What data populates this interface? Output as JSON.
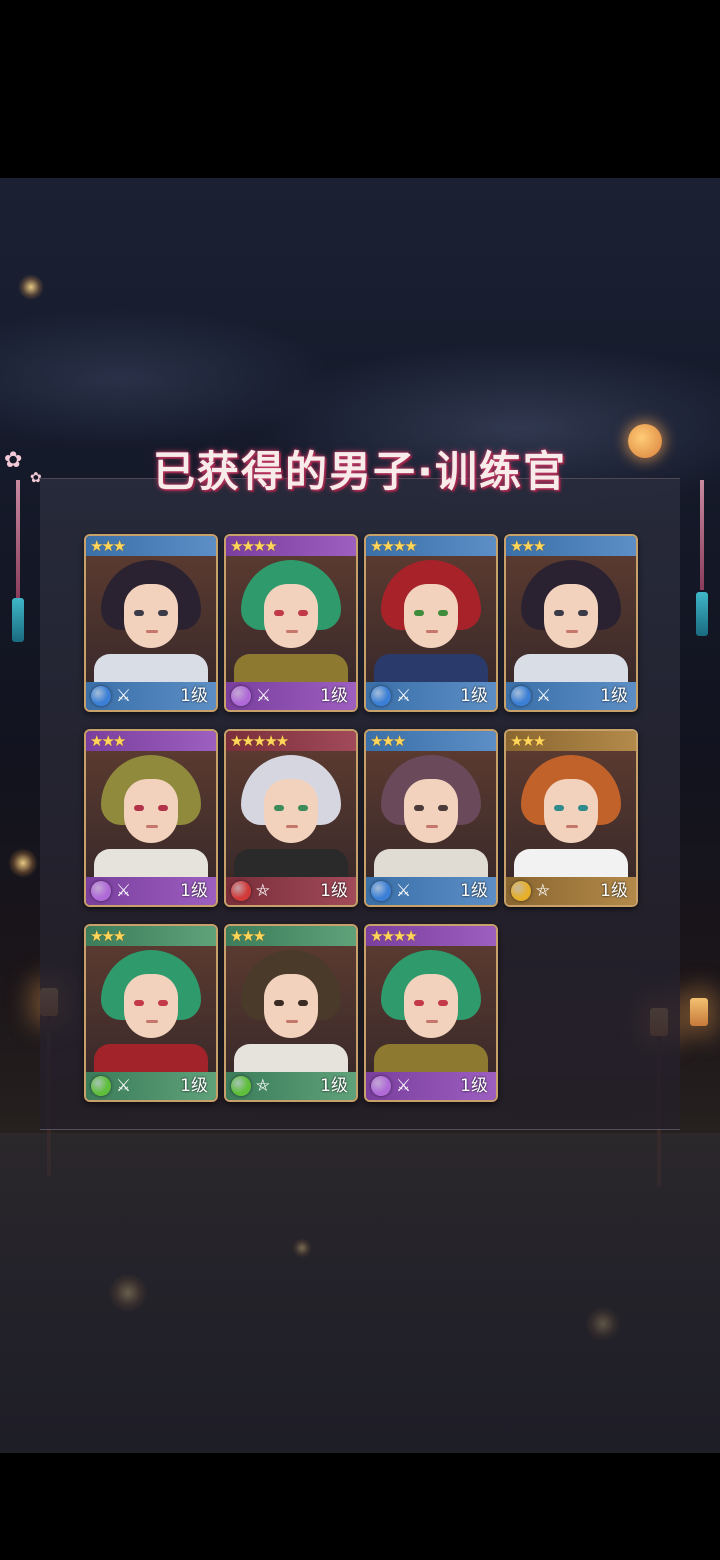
{
  "title": "已获得的男子·训练官",
  "cards": [
    {
      "stars": "★★★",
      "attr": "water",
      "weapon": "swords",
      "level": "1级",
      "frame": "blue",
      "hair": "#2a2230",
      "eye": "#3b3b48",
      "outfit": "#d9dde6"
    },
    {
      "stars": "★★★★",
      "attr": "wind",
      "weapon": "swords",
      "level": "1级",
      "frame": "purple",
      "hair": "#2f9a6c",
      "eye": "#c23a48",
      "outfit": "#8d7a30"
    },
    {
      "stars": "★★★★",
      "attr": "water",
      "weapon": "swords",
      "level": "1级",
      "frame": "blue",
      "hair": "#a8222a",
      "eye": "#3f8c3c",
      "outfit": "#2a3a6a"
    },
    {
      "stars": "★★★",
      "attr": "water",
      "weapon": "swords",
      "level": "1级",
      "frame": "blue",
      "hair": "#2a2230",
      "eye": "#3b3b48",
      "outfit": "#d9dde6"
    },
    {
      "stars": "★★★",
      "attr": "wind",
      "weapon": "swords",
      "level": "1级",
      "frame": "purple",
      "hair": "#8f8a3c",
      "eye": "#b2324a",
      "outfit": "#e6e2dc"
    },
    {
      "stars": "★★★★★",
      "attr": "fire",
      "weapon": "pentagram",
      "level": "1级",
      "frame": "red",
      "hair": "#d6d6e0",
      "eye": "#3c8c5a",
      "outfit": "#2a2a2a"
    },
    {
      "stars": "★★★",
      "attr": "water",
      "weapon": "swords",
      "level": "1级",
      "frame": "blue",
      "hair": "#6a4a5a",
      "eye": "#4a3a3a",
      "outfit": "#e0dcd4"
    },
    {
      "stars": "★★★",
      "attr": "earth",
      "weapon": "pentagram",
      "level": "1级",
      "frame": "gold",
      "hair": "#c0622a",
      "eye": "#2f8a8c",
      "outfit": "#f2f2f2"
    },
    {
      "stars": "★★★",
      "attr": "leaf",
      "weapon": "swords",
      "level": "1级",
      "frame": "green",
      "hair": "#2f9a6c",
      "eye": "#c23a48",
      "outfit": "#a2232a"
    },
    {
      "stars": "★★★",
      "attr": "leaf",
      "weapon": "pentagram",
      "level": "1级",
      "frame": "green",
      "hair": "#4a3a2a",
      "eye": "#3a2a22",
      "outfit": "#e6e2dc"
    },
    {
      "stars": "★★★★",
      "attr": "wind",
      "weapon": "swords",
      "level": "1级",
      "frame": "purple",
      "hair": "#2f9a6c",
      "eye": "#c23a48",
      "outfit": "#8d7a30"
    }
  ],
  "icons": {
    "swords": "⚔",
    "pentagram": "⛤"
  },
  "attr_colors": {
    "water": "#3b7fd6",
    "wind": "#b06ad8",
    "fire": "#d23a3a",
    "earth": "#e6b02a",
    "leaf": "#5fbf3a"
  }
}
